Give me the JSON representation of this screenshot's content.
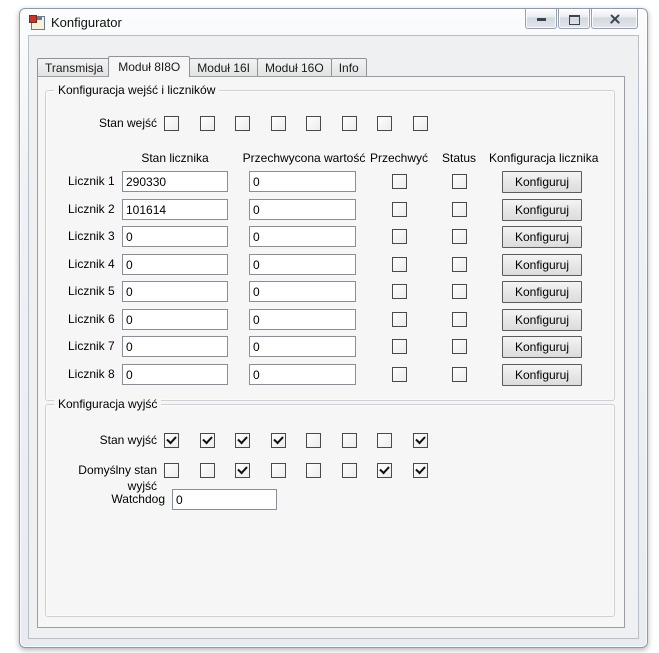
{
  "window": {
    "title": "Konfigurator"
  },
  "icons": {
    "app_icon": "winforms-form-icon",
    "minimize": "dash-glyph",
    "maximize": "square-outline-glyph",
    "close": "x-cross-glyph",
    "checkbox_checked": "check-mark"
  },
  "tabs": [
    {
      "label": "Transmisja",
      "active": false
    },
    {
      "label": "Moduł 8I8O",
      "active": true
    },
    {
      "label": "Moduł 16I",
      "active": false
    },
    {
      "label": "Moduł 16O",
      "active": false
    },
    {
      "label": "Info",
      "active": false
    }
  ],
  "inputs_group": {
    "title": "Konfiguracja wejść i liczników",
    "stan_wejsc_label": "Stan wejść",
    "stan_wejsc": [
      false,
      false,
      false,
      false,
      false,
      false,
      false,
      false
    ],
    "columns": {
      "stan": "Stan licznika",
      "przechwycona": "Przechwycona wartość",
      "przechwyc": "Przechwyć",
      "status": "Status",
      "konfiguracja": "Konfiguracja licznika"
    },
    "rows": [
      {
        "label": "Licznik 1",
        "stan": "290330",
        "przechwycona": "0",
        "przechwyc": false,
        "status": false,
        "button": "Konfiguruj"
      },
      {
        "label": "Licznik 2",
        "stan": "101614",
        "przechwycona": "0",
        "przechwyc": false,
        "status": false,
        "button": "Konfiguruj"
      },
      {
        "label": "Licznik 3",
        "stan": "0",
        "przechwycona": "0",
        "przechwyc": false,
        "status": false,
        "button": "Konfiguruj"
      },
      {
        "label": "Licznik 4",
        "stan": "0",
        "przechwycona": "0",
        "przechwyc": false,
        "status": false,
        "button": "Konfiguruj"
      },
      {
        "label": "Licznik 5",
        "stan": "0",
        "przechwycona": "0",
        "przechwyc": false,
        "status": false,
        "button": "Konfiguruj"
      },
      {
        "label": "Licznik 6",
        "stan": "0",
        "przechwycona": "0",
        "przechwyc": false,
        "status": false,
        "button": "Konfiguruj"
      },
      {
        "label": "Licznik 7",
        "stan": "0",
        "przechwycona": "0",
        "przechwyc": false,
        "status": false,
        "button": "Konfiguruj"
      },
      {
        "label": "Licznik 8",
        "stan": "0",
        "przechwycona": "0",
        "przechwyc": false,
        "status": false,
        "button": "Konfiguruj"
      }
    ]
  },
  "outputs_group": {
    "title": "Konfiguracja wyjść",
    "stan_wyjsc_label": "Stan wyjść",
    "stan_wyjsc": [
      true,
      true,
      true,
      true,
      false,
      false,
      false,
      true
    ],
    "domyslny_label": "Domyślny stan wyjść",
    "domyslny_stan": [
      false,
      false,
      true,
      false,
      false,
      false,
      true,
      true
    ],
    "watchdog_label": "Watchdog",
    "watchdog_value": "0"
  }
}
